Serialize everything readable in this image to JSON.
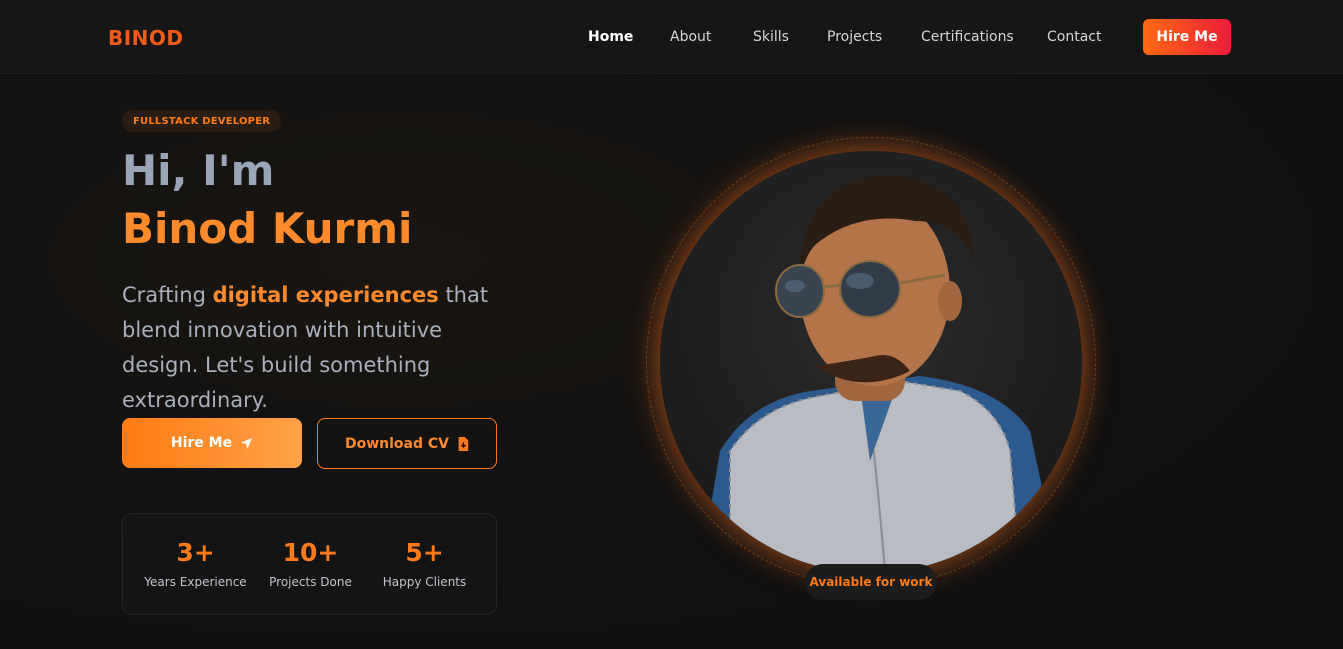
{
  "nav": {
    "logo": "BINOD",
    "links": [
      "Home",
      "About",
      "Skills",
      "Projects",
      "Certifications",
      "Contact"
    ],
    "active": "Home",
    "hire_label": "Hire Me"
  },
  "hero": {
    "badge": "FULLSTACK DEVELOPER",
    "greeting": "Hi, I'm",
    "name": "Binod Kurmi",
    "tagline_start": "Crafting ",
    "tagline_highlight": "digital experiences",
    "tagline_end": " that blend innovation with intuitive design. Let's build something extraordinary.",
    "hire_button": "Hire Me",
    "cv_button": "Download CV"
  },
  "stats": [
    {
      "value": "3+",
      "label": "Years Experience"
    },
    {
      "value": "10+",
      "label": "Projects Done"
    },
    {
      "value": "5+",
      "label": "Happy Clients"
    }
  ],
  "profile": {
    "availability": "Available for work"
  },
  "icons": {
    "hire": "paper-plane-icon",
    "cv": "file-download-icon"
  },
  "colors": {
    "accent": "#ff7a1a",
    "accent_red": "#ee1c3a",
    "background": "#121212"
  }
}
